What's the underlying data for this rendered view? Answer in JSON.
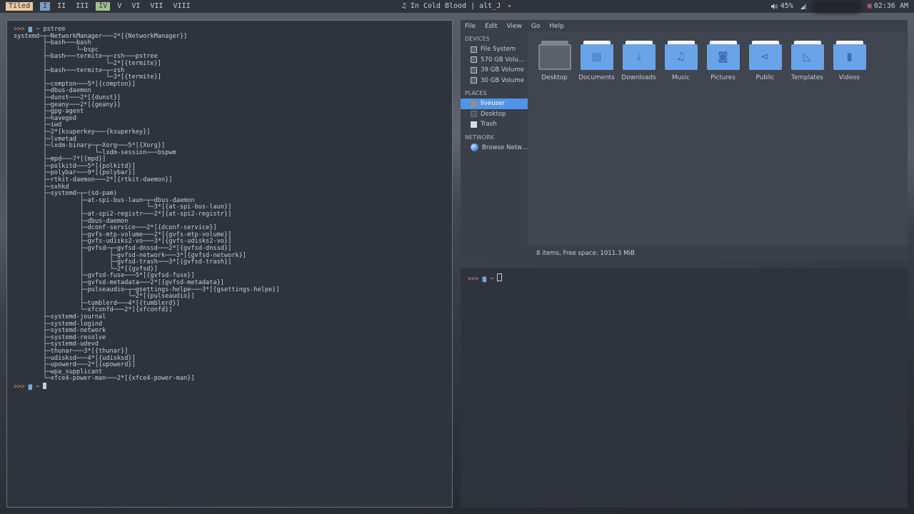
{
  "bar": {
    "layout": "Tiled",
    "workspaces": [
      "I",
      "II",
      "III",
      "IV",
      "V",
      "VI",
      "VII",
      "VIII"
    ],
    "now_playing": "In Cold Blood | alt_J",
    "next_icon": "▸",
    "volume": "45%",
    "time": "02:36 AM"
  },
  "term_left": {
    "prompt_arrows": ">>>",
    "command": "pstree",
    "tree": [
      "systemd─┬─NetworkManager───2*[{NetworkManager}]",
      "        ├─bash───bash",
      "        │        └─bspc",
      "        ├─bash───termite─┬─zsh───pstree",
      "        │                └─2*[{termite}]",
      "        ├─bash───termite─┬─zsh",
      "        │                └─3*[{termite}]",
      "        ├─compton───5*[{compton}]",
      "        ├─dbus-daemon",
      "        ├─dunst───2*[{dunst}]",
      "        ├─geany───2*[{geany}]",
      "        ├─gpg-agent",
      "        ├─haveged",
      "        ├─iwd",
      "        ├─2*[ksuperkey───{ksuperkey}]",
      "        ├─lvmetad",
      "        ├─lxdm-binary─┬─Xorg───5*[{Xorg}]",
      "        │             └─lxdm-session───bspwm",
      "        ├─mpd───7*[{mpd}]",
      "        ├─polkitd───5*[{polkitd}]",
      "        ├─polybar───9*[{polybar}]",
      "        ├─rtkit-daemon───2*[{rtkit-daemon}]",
      "        ├─sxhkd",
      "        ├─systemd─┬─(sd-pam)",
      "        │         ├─at-spi-bus-laun─┬─dbus-daemon",
      "        │         │                 └─3*[{at-spi-bus-laun}]",
      "        │         ├─at-spi2-registr───2*[{at-spi2-registr}]",
      "        │         ├─dbus-daemon",
      "        │         ├─dconf-service───2*[{dconf-service}]",
      "        │         ├─gvfs-mtp-volume───2*[{gvfs-mtp-volume}]",
      "        │         ├─gvfs-udisks2-vo───3*[{gvfs-udisks2-vo}]",
      "        │         ├─gvfsd─┬─gvfsd-dnssd───2*[{gvfsd-dnssd}]",
      "        │         │       ├─gvfsd-network───3*[{gvfsd-network}]",
      "        │         │       ├─gvfsd-trash───3*[{gvfsd-trash}]",
      "        │         │       └─2*[{gvfsd}]",
      "        │         ├─gvfsd-fuse───5*[{gvfsd-fuse}]",
      "        │         ├─gvfsd-metadata───2*[{gvfsd-metadata}]",
      "        │         ├─pulseaudio─┬─gsettings-helpe───3*[{gsettings-helpe}]",
      "        │         │            └─2*[{pulseaudio}]",
      "        │         ├─tumblerd───4*[{tumblerd}]",
      "        │         └─xfconfd───2*[{xfconfd}]",
      "        ├─systemd-journal",
      "        ├─systemd-logind",
      "        ├─systemd-network",
      "        ├─systemd-resolve",
      "        ├─systemd-udevd",
      "        ├─thunar───3*[{thunar}]",
      "        ├─udisksd───4*[{udisksd}]",
      "        ├─upowerd───2*[{upowerd}]",
      "        ├─wpa_supplicant",
      "        └─xfce4-power-man───2*[{xfce4-power-man}]"
    ]
  },
  "file_manager": {
    "menu": [
      "File",
      "Edit",
      "View",
      "Go",
      "Help"
    ],
    "devices_header": "DEVICES",
    "devices": [
      "File System",
      "570 GB Volu…",
      "39 GB Volume",
      "30 GB Volume"
    ],
    "places_header": "PLACES",
    "places": [
      "liveuser",
      "Desktop",
      "Trash"
    ],
    "network_header": "NETWORK",
    "network": [
      "Browse Netw…"
    ],
    "files": [
      {
        "name": "Desktop",
        "glyph": ""
      },
      {
        "name": "Documents",
        "glyph": "▤"
      },
      {
        "name": "Downloads",
        "glyph": "⤓"
      },
      {
        "name": "Music",
        "glyph": "♫"
      },
      {
        "name": "Pictures",
        "glyph": "◙"
      },
      {
        "name": "Public",
        "glyph": "⋖"
      },
      {
        "name": "Templates",
        "glyph": "◺"
      },
      {
        "name": "Videos",
        "glyph": "▮"
      }
    ],
    "status": "8 items, Free space: 1011.3 MiB"
  },
  "term_right": {
    "prompt_arrows": ">>>",
    "tilde": "~"
  }
}
